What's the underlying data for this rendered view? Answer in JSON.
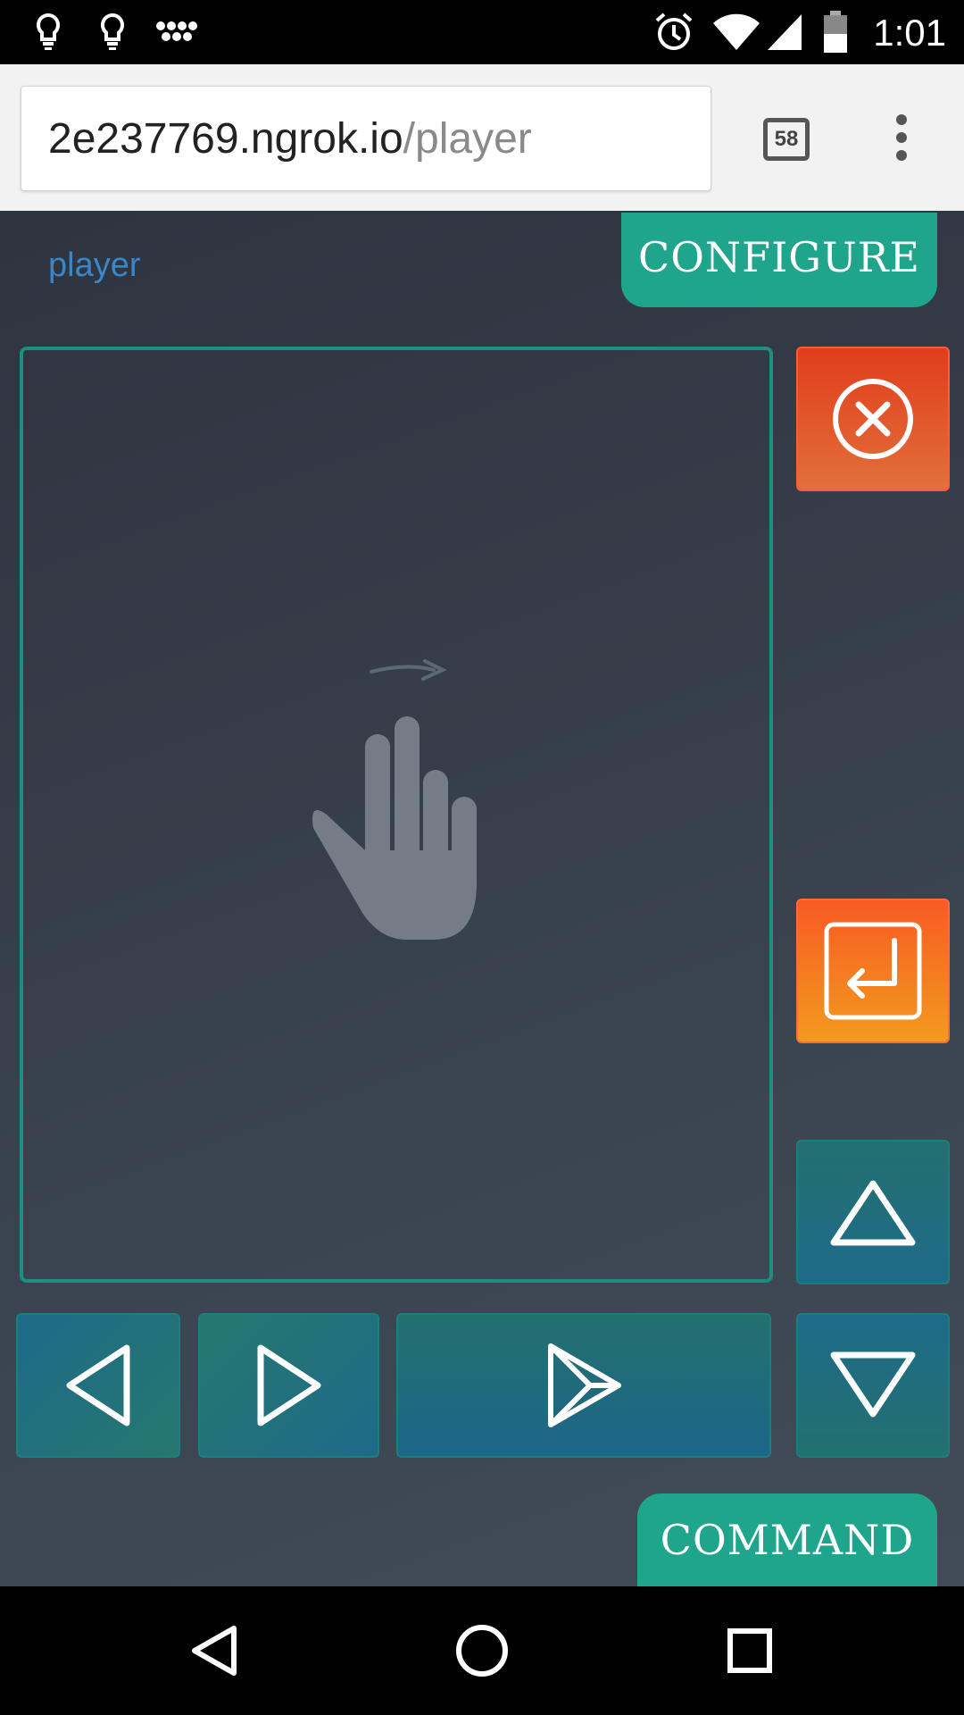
{
  "status_bar": {
    "time": "1:01",
    "left_icons": [
      "lightbulb-icon",
      "lightbulb-icon",
      "grid-dots-icon"
    ],
    "right_icons": [
      "alarm-icon",
      "wifi-icon",
      "signal-icon",
      "battery-icon"
    ]
  },
  "browser": {
    "url_host": "2e237769.ngrok.io",
    "url_path": "/player",
    "tab_count": "58",
    "load_progress": 0.4,
    "menu_icon": "more-vert-icon"
  },
  "page": {
    "player_link": "player",
    "configure_label": "CONFIGURE",
    "command_label": "COMMAND",
    "touchpad_icon": "two-finger-swipe-icon",
    "buttons": {
      "close": "close-circle-icon",
      "enter": "enter-icon",
      "up": "triangle-up-icon",
      "down": "triangle-down-icon",
      "left": "triangle-left-icon",
      "right": "triangle-right-icon",
      "play": "play-icon"
    },
    "colors": {
      "accent_teal": "#1fa58b",
      "close_red": "#e03d1c",
      "enter_orange": "#f85a24",
      "link_blue": "#3a86c8"
    }
  },
  "nav_bar": {
    "back_icon": "back-icon",
    "home_icon": "home-icon",
    "recents_icon": "recents-icon"
  }
}
